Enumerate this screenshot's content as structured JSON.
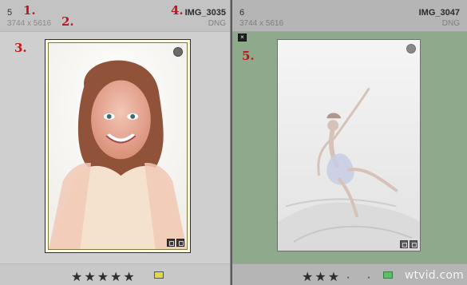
{
  "cells": [
    {
      "index": "5",
      "dimensions": "3744 x 5616",
      "filename": "IMG_3035",
      "extension": "DNG",
      "rating_stars": "★★★★★",
      "rating_value": 5,
      "color_label": "yellow",
      "color_label_hex": "#dfd84a"
    },
    {
      "index": "6",
      "dimensions": "3744 x 5616",
      "filename": "IMG_3047",
      "extension": "DNG",
      "rating_stars": "★★★",
      "rating_extra_dots": "· ·",
      "rating_value": 3,
      "color_label": "green",
      "color_label_hex": "#56c267",
      "rejected_flag": "×"
    }
  ],
  "annotations": {
    "a1": "1.",
    "a2": "2.",
    "a3": "3.",
    "a4": "4.",
    "a5": "5."
  },
  "watermark": "wtvid.com",
  "icons": {
    "photo_badge": "circle-badge",
    "corner_icons": [
      "copy-icon",
      "edit-icon"
    ]
  }
}
